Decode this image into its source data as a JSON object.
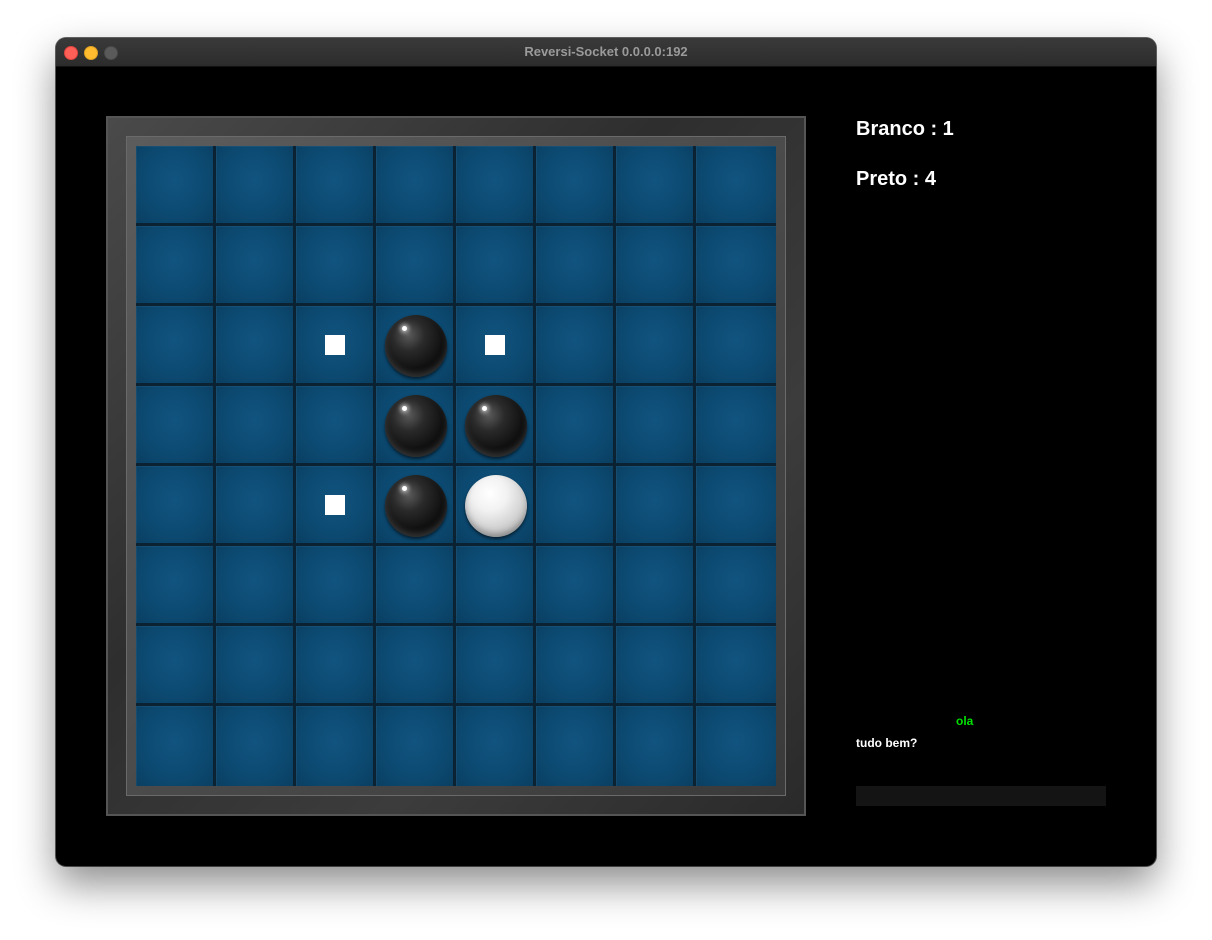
{
  "window": {
    "title": "Reversi-Socket 0.0.0.0:192"
  },
  "score": {
    "white_label": "Branco : 1",
    "black_label": "Preto : 4"
  },
  "board": {
    "size": 8,
    "colors": {
      "cell": "#0c4a72",
      "grid_line": "#0a2231",
      "hint": "#ffffff"
    },
    "pieces": [
      {
        "row": 2,
        "col": 3,
        "color": "black"
      },
      {
        "row": 3,
        "col": 3,
        "color": "black"
      },
      {
        "row": 3,
        "col": 4,
        "color": "black"
      },
      {
        "row": 4,
        "col": 3,
        "color": "black"
      },
      {
        "row": 4,
        "col": 4,
        "color": "white"
      }
    ],
    "valid_moves": [
      {
        "row": 2,
        "col": 2
      },
      {
        "row": 2,
        "col": 4
      },
      {
        "row": 4,
        "col": 2
      }
    ]
  },
  "chat": {
    "messages": [
      {
        "text": "ola",
        "sender": "remote",
        "color": "#00e000"
      },
      {
        "text": "tudo bem?",
        "sender": "local",
        "color": "#ffffff"
      }
    ],
    "input_value": ""
  }
}
